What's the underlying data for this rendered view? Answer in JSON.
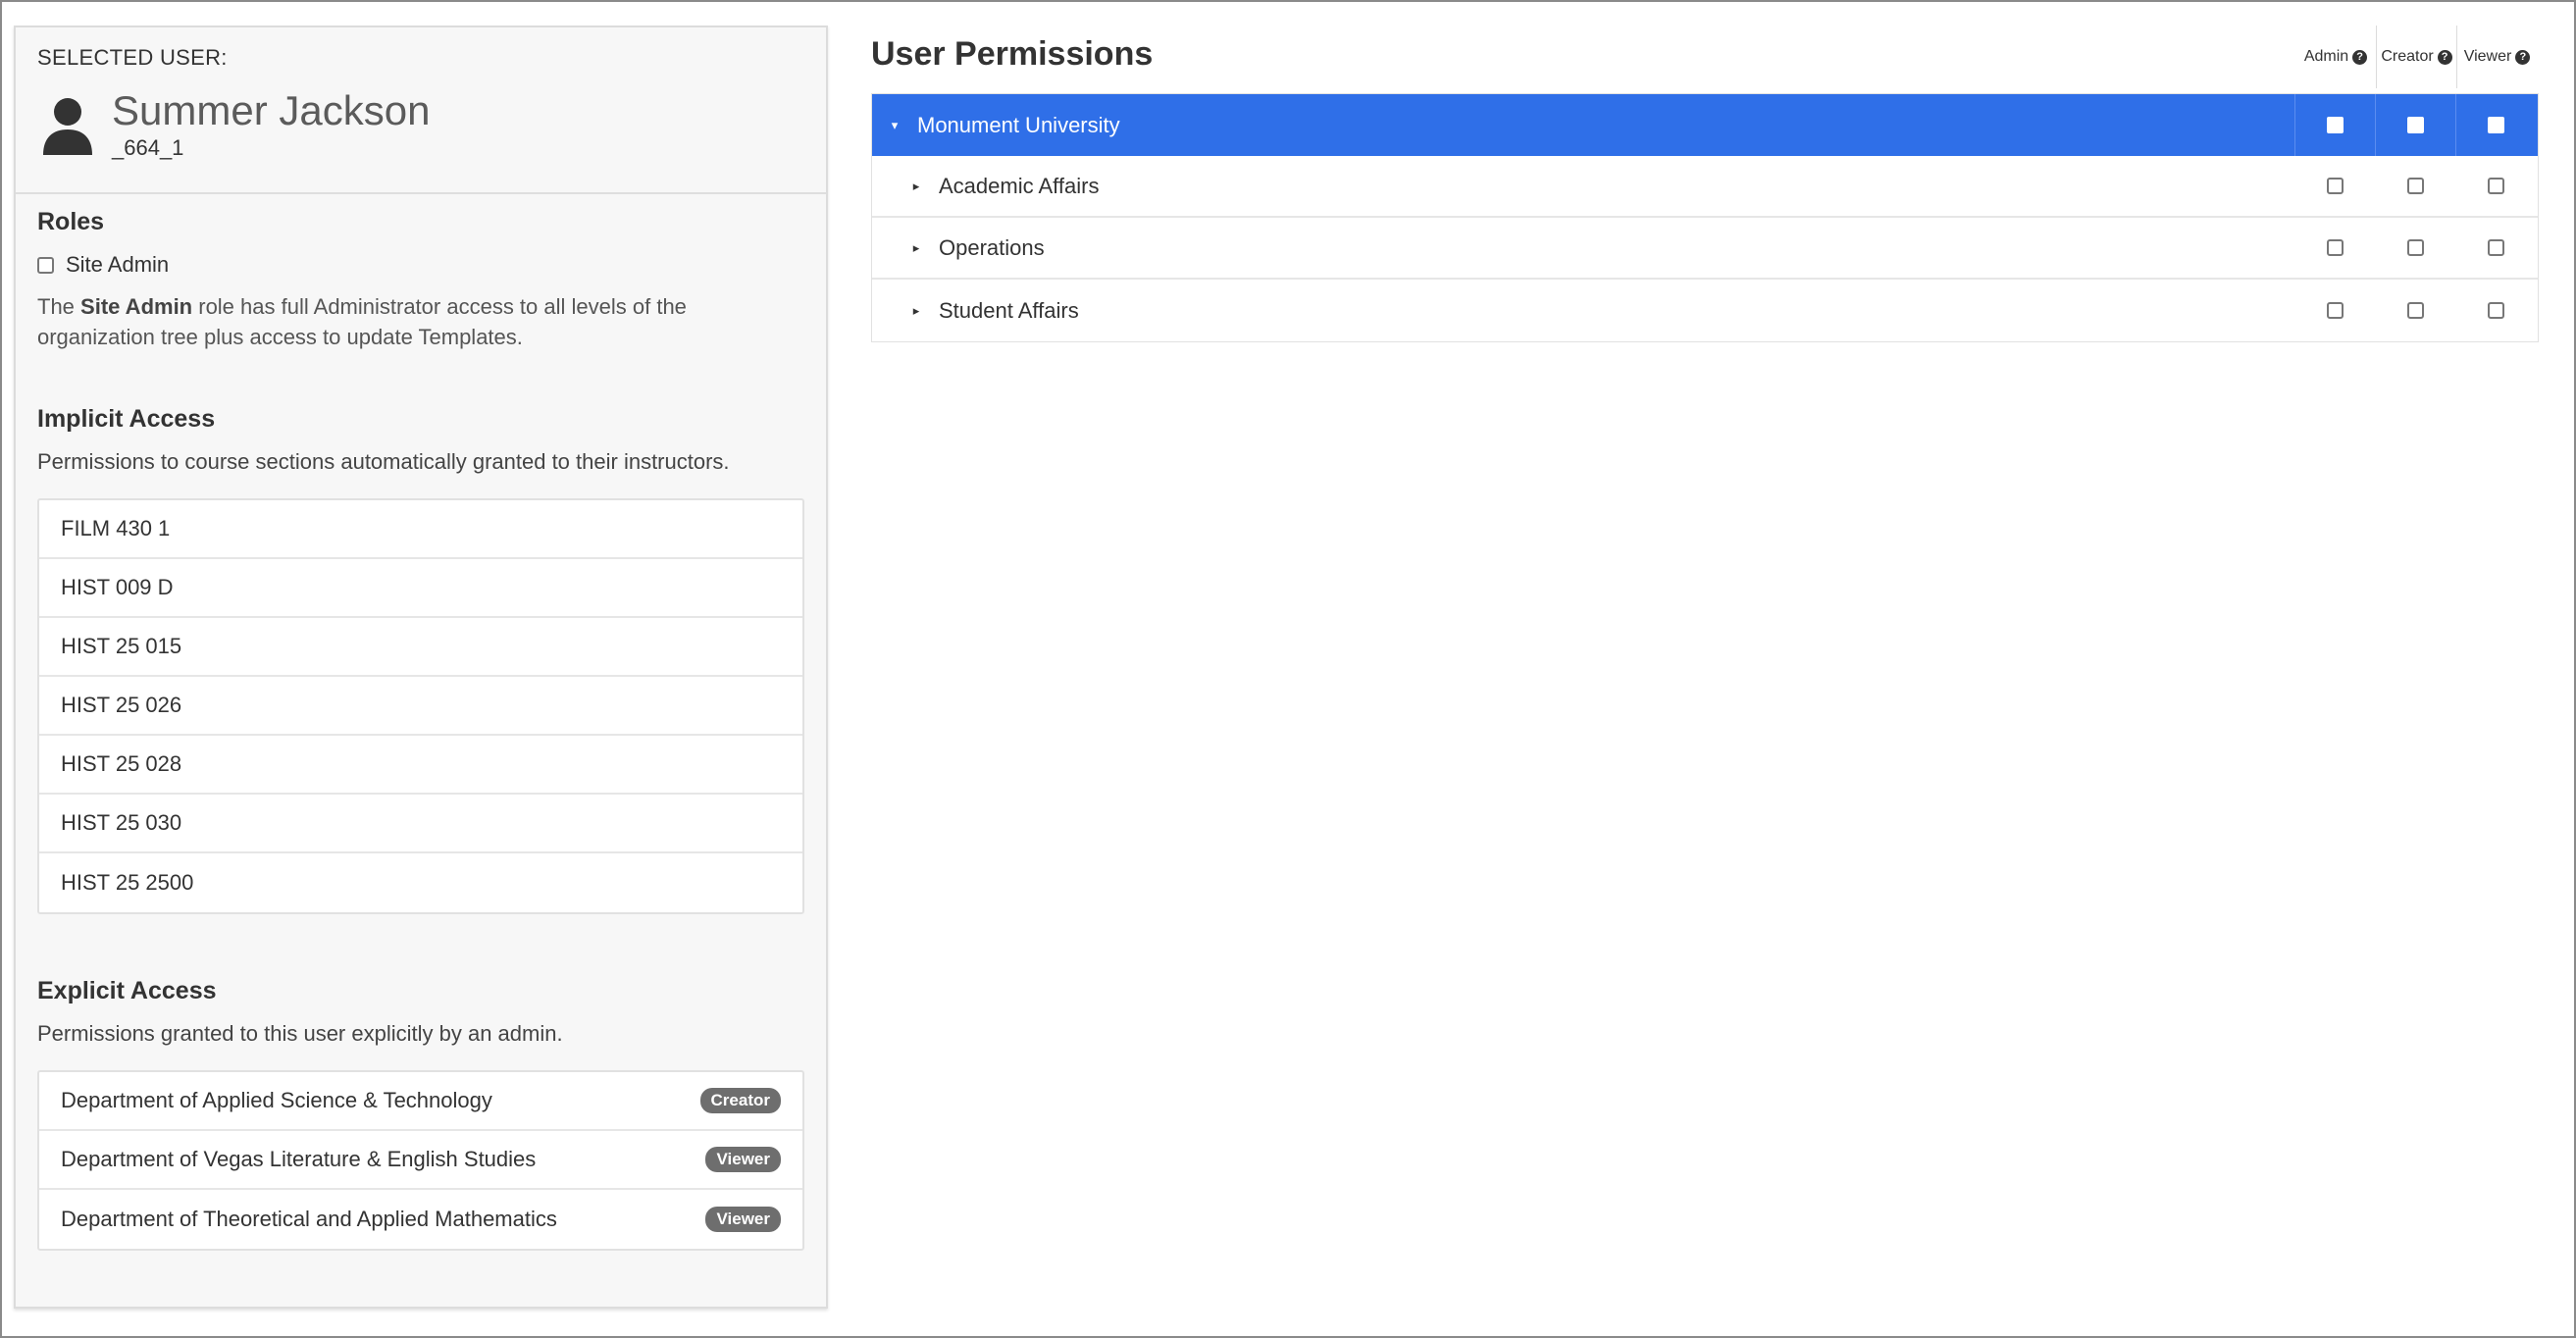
{
  "selected_user": {
    "label": "SELECTED USER:",
    "name": "Summer Jackson",
    "id": "_664_1"
  },
  "roles": {
    "heading": "Roles",
    "site_admin_label": "Site Admin",
    "site_admin_checked": false,
    "desc_prefix": "The ",
    "desc_bold": "Site Admin",
    "desc_suffix": " role has full Administrator access to all levels of the organization tree plus access to update Templates."
  },
  "implicit_access": {
    "heading": "Implicit Access",
    "description": "Permissions to course sections automatically granted to their instructors.",
    "items": [
      "FILM 430 1",
      "HIST 009 D",
      "HIST 25 015",
      "HIST 25 026",
      "HIST 25 028",
      "HIST 25 030",
      "HIST 25 2500"
    ]
  },
  "explicit_access": {
    "heading": "Explicit Access",
    "description": "Permissions granted to this user explicitly by an admin.",
    "items": [
      {
        "name": "Department of Applied Science & Technology",
        "role": "Creator"
      },
      {
        "name": "Department of Vegas Literature & English Studies",
        "role": "Viewer"
      },
      {
        "name": "Department of Theoretical and Applied Mathematics",
        "role": "Viewer"
      }
    ]
  },
  "permissions": {
    "title": "User Permissions",
    "columns": [
      "Admin",
      "Creator",
      "Viewer"
    ],
    "tree": [
      {
        "label": "Monument University",
        "expanded": true,
        "selected": true
      },
      {
        "label": "Academic Affairs",
        "expanded": false,
        "selected": false
      },
      {
        "label": "Operations",
        "expanded": false,
        "selected": false
      },
      {
        "label": "Student Affairs",
        "expanded": false,
        "selected": false
      }
    ]
  },
  "colors": {
    "selected_row": "#2f6fe8",
    "badge": "#6e6e6e",
    "panel_bg": "#f7f7f7"
  },
  "icons": {
    "avatar": "user-silhouette-icon",
    "help": "question-circle-icon",
    "expanded": "caret-down-icon",
    "collapsed": "caret-right-icon"
  }
}
